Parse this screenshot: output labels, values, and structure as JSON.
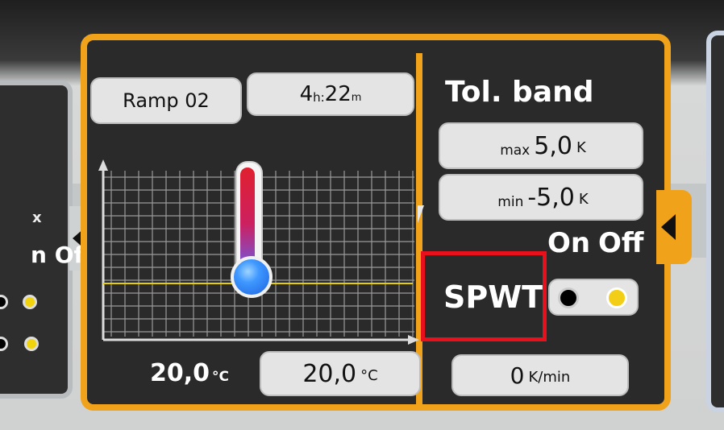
{
  "left_panel": {
    "partial_label": "x",
    "on_label": "n",
    "off_label": "Off"
  },
  "program": {
    "name": "Ramp 02",
    "duration_hours": "4",
    "duration_h_unit": "h:",
    "duration_minutes": "22",
    "duration_m_unit": "m"
  },
  "temperature": {
    "actual_value": "20,0",
    "actual_unit": "°C",
    "setpoint_value": "20,0",
    "setpoint_unit": "°C"
  },
  "tolerance_band": {
    "title": "Tol. band",
    "max_label": "max",
    "max_value": "5,0",
    "max_unit": "K",
    "min_label": "min",
    "min_value": "-5,0",
    "min_unit": "K"
  },
  "spwt": {
    "label": "SPWT",
    "on_label": "On",
    "off_label": "Off",
    "selected": "Off"
  },
  "gradient": {
    "value": "0",
    "unit": "K/min"
  },
  "colors": {
    "accent": "#f0a21a",
    "panel_bg": "#2a2a2a",
    "pill_bg": "#e4e4e4",
    "highlight": "#e8101a",
    "yellow_indicator": "#f2cf16"
  }
}
